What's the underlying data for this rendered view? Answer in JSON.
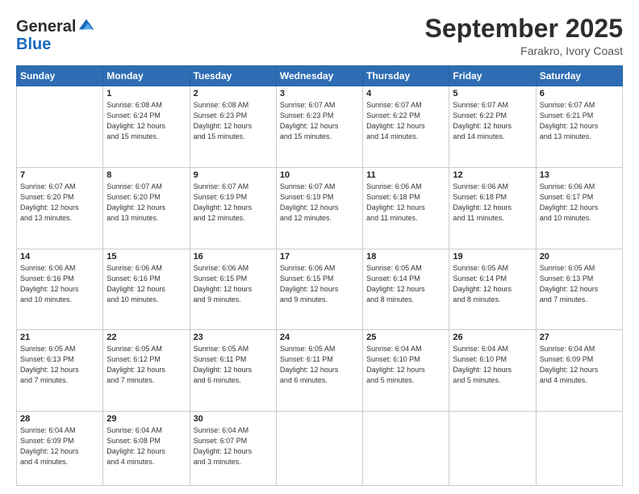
{
  "header": {
    "logo_general": "General",
    "logo_blue": "Blue",
    "month_title": "September 2025",
    "location": "Farakro, Ivory Coast"
  },
  "weekdays": [
    "Sunday",
    "Monday",
    "Tuesday",
    "Wednesday",
    "Thursday",
    "Friday",
    "Saturday"
  ],
  "weeks": [
    [
      {
        "day": "",
        "info": ""
      },
      {
        "day": "1",
        "info": "Sunrise: 6:08 AM\nSunset: 6:24 PM\nDaylight: 12 hours\nand 15 minutes."
      },
      {
        "day": "2",
        "info": "Sunrise: 6:08 AM\nSunset: 6:23 PM\nDaylight: 12 hours\nand 15 minutes."
      },
      {
        "day": "3",
        "info": "Sunrise: 6:07 AM\nSunset: 6:23 PM\nDaylight: 12 hours\nand 15 minutes."
      },
      {
        "day": "4",
        "info": "Sunrise: 6:07 AM\nSunset: 6:22 PM\nDaylight: 12 hours\nand 14 minutes."
      },
      {
        "day": "5",
        "info": "Sunrise: 6:07 AM\nSunset: 6:22 PM\nDaylight: 12 hours\nand 14 minutes."
      },
      {
        "day": "6",
        "info": "Sunrise: 6:07 AM\nSunset: 6:21 PM\nDaylight: 12 hours\nand 13 minutes."
      }
    ],
    [
      {
        "day": "7",
        "info": "Sunrise: 6:07 AM\nSunset: 6:20 PM\nDaylight: 12 hours\nand 13 minutes."
      },
      {
        "day": "8",
        "info": "Sunrise: 6:07 AM\nSunset: 6:20 PM\nDaylight: 12 hours\nand 13 minutes."
      },
      {
        "day": "9",
        "info": "Sunrise: 6:07 AM\nSunset: 6:19 PM\nDaylight: 12 hours\nand 12 minutes."
      },
      {
        "day": "10",
        "info": "Sunrise: 6:07 AM\nSunset: 6:19 PM\nDaylight: 12 hours\nand 12 minutes."
      },
      {
        "day": "11",
        "info": "Sunrise: 6:06 AM\nSunset: 6:18 PM\nDaylight: 12 hours\nand 11 minutes."
      },
      {
        "day": "12",
        "info": "Sunrise: 6:06 AM\nSunset: 6:18 PM\nDaylight: 12 hours\nand 11 minutes."
      },
      {
        "day": "13",
        "info": "Sunrise: 6:06 AM\nSunset: 6:17 PM\nDaylight: 12 hours\nand 10 minutes."
      }
    ],
    [
      {
        "day": "14",
        "info": "Sunrise: 6:06 AM\nSunset: 6:16 PM\nDaylight: 12 hours\nand 10 minutes."
      },
      {
        "day": "15",
        "info": "Sunrise: 6:06 AM\nSunset: 6:16 PM\nDaylight: 12 hours\nand 10 minutes."
      },
      {
        "day": "16",
        "info": "Sunrise: 6:06 AM\nSunset: 6:15 PM\nDaylight: 12 hours\nand 9 minutes."
      },
      {
        "day": "17",
        "info": "Sunrise: 6:06 AM\nSunset: 6:15 PM\nDaylight: 12 hours\nand 9 minutes."
      },
      {
        "day": "18",
        "info": "Sunrise: 6:05 AM\nSunset: 6:14 PM\nDaylight: 12 hours\nand 8 minutes."
      },
      {
        "day": "19",
        "info": "Sunrise: 6:05 AM\nSunset: 6:14 PM\nDaylight: 12 hours\nand 8 minutes."
      },
      {
        "day": "20",
        "info": "Sunrise: 6:05 AM\nSunset: 6:13 PM\nDaylight: 12 hours\nand 7 minutes."
      }
    ],
    [
      {
        "day": "21",
        "info": "Sunrise: 6:05 AM\nSunset: 6:13 PM\nDaylight: 12 hours\nand 7 minutes."
      },
      {
        "day": "22",
        "info": "Sunrise: 6:05 AM\nSunset: 6:12 PM\nDaylight: 12 hours\nand 7 minutes."
      },
      {
        "day": "23",
        "info": "Sunrise: 6:05 AM\nSunset: 6:11 PM\nDaylight: 12 hours\nand 6 minutes."
      },
      {
        "day": "24",
        "info": "Sunrise: 6:05 AM\nSunset: 6:11 PM\nDaylight: 12 hours\nand 6 minutes."
      },
      {
        "day": "25",
        "info": "Sunrise: 6:04 AM\nSunset: 6:10 PM\nDaylight: 12 hours\nand 5 minutes."
      },
      {
        "day": "26",
        "info": "Sunrise: 6:04 AM\nSunset: 6:10 PM\nDaylight: 12 hours\nand 5 minutes."
      },
      {
        "day": "27",
        "info": "Sunrise: 6:04 AM\nSunset: 6:09 PM\nDaylight: 12 hours\nand 4 minutes."
      }
    ],
    [
      {
        "day": "28",
        "info": "Sunrise: 6:04 AM\nSunset: 6:09 PM\nDaylight: 12 hours\nand 4 minutes."
      },
      {
        "day": "29",
        "info": "Sunrise: 6:04 AM\nSunset: 6:08 PM\nDaylight: 12 hours\nand 4 minutes."
      },
      {
        "day": "30",
        "info": "Sunrise: 6:04 AM\nSunset: 6:07 PM\nDaylight: 12 hours\nand 3 minutes."
      },
      {
        "day": "",
        "info": ""
      },
      {
        "day": "",
        "info": ""
      },
      {
        "day": "",
        "info": ""
      },
      {
        "day": "",
        "info": ""
      }
    ]
  ]
}
